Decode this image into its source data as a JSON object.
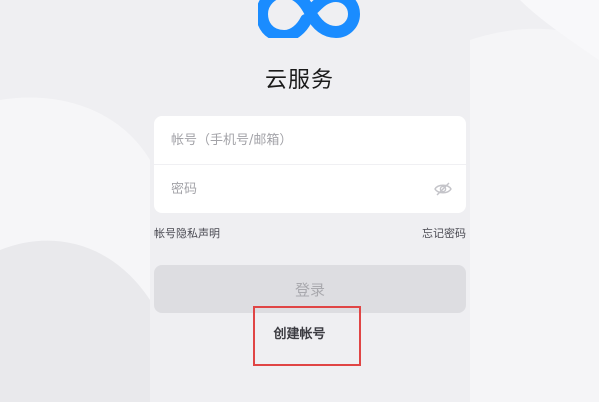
{
  "app": {
    "title": "云服务"
  },
  "form": {
    "account_placeholder": "帐号（手机号/邮箱）",
    "password_placeholder": "密码"
  },
  "links": {
    "privacy": "帐号隐私声明",
    "forgot": "忘记密码"
  },
  "buttons": {
    "login": "登录",
    "create_account": "创建帐号"
  },
  "colors": {
    "brand": "#1a8cff",
    "highlight_box": "#e04545",
    "login_disabled_bg": "#dddde1"
  },
  "icons": {
    "logo": "cloud-infinity-logo",
    "password_toggle": "eye-off-icon"
  }
}
